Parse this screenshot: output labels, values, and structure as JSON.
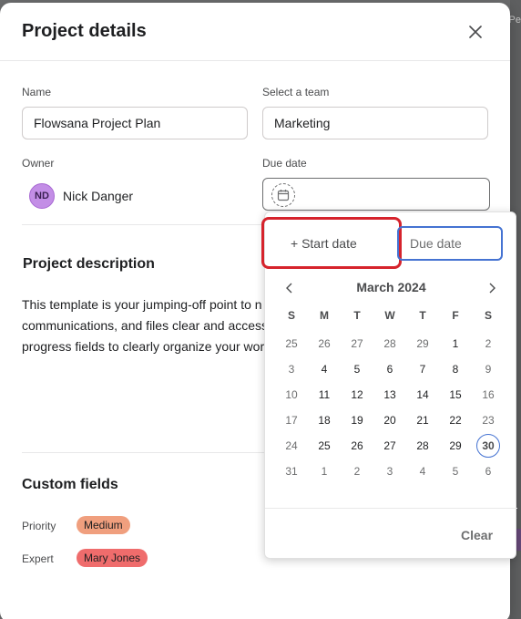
{
  "backdrop": {
    "text": "Pe"
  },
  "dialog": {
    "title": "Project details",
    "name_label": "Name",
    "name_value": "Flowsana Project Plan",
    "team_label": "Select a team",
    "team_value": "Marketing",
    "owner_label": "Owner",
    "owner_initials": "ND",
    "owner_name": "Nick Danger",
    "due_label": "Due date",
    "description_title": "Project description",
    "description_lines": [
      "This template is your jumping-off point to n",
      "communications, and files clear and accessi",
      "progress fields to clearly organize your wor"
    ],
    "custom_fields_title": "Custom fields",
    "custom_fields": [
      {
        "label": "Priority",
        "value": "Medium",
        "color": "#f09f7e"
      },
      {
        "label": "Expert",
        "value": "Mary Jones",
        "color": "#ef6c6c"
      }
    ]
  },
  "picker": {
    "start_date_label": "+ Start date",
    "due_date_placeholder": "Due date",
    "month": "March 2024",
    "weekdays": [
      "S",
      "M",
      "T",
      "W",
      "T",
      "F",
      "S"
    ],
    "weeks": [
      [
        [
          "25",
          true
        ],
        [
          "26",
          true
        ],
        [
          "27",
          true
        ],
        [
          "28",
          true
        ],
        [
          "29",
          true
        ],
        [
          "1",
          false
        ],
        [
          "2",
          true
        ]
      ],
      [
        [
          "3",
          true
        ],
        [
          "4",
          false
        ],
        [
          "5",
          false
        ],
        [
          "6",
          false
        ],
        [
          "7",
          false
        ],
        [
          "8",
          false
        ],
        [
          "9",
          true
        ]
      ],
      [
        [
          "10",
          true
        ],
        [
          "11",
          false
        ],
        [
          "12",
          false
        ],
        [
          "13",
          false
        ],
        [
          "14",
          false
        ],
        [
          "15",
          false
        ],
        [
          "16",
          true
        ]
      ],
      [
        [
          "17",
          true
        ],
        [
          "18",
          false
        ],
        [
          "19",
          false
        ],
        [
          "20",
          false
        ],
        [
          "21",
          false
        ],
        [
          "22",
          false
        ],
        [
          "23",
          true
        ]
      ],
      [
        [
          "24",
          true
        ],
        [
          "25",
          false
        ],
        [
          "26",
          false
        ],
        [
          "27",
          false
        ],
        [
          "28",
          false
        ],
        [
          "29",
          false
        ],
        [
          "30",
          false
        ]
      ],
      [
        [
          "31",
          true
        ],
        [
          "1",
          true
        ],
        [
          "2",
          true
        ],
        [
          "3",
          true
        ],
        [
          "4",
          true
        ],
        [
          "5",
          true
        ],
        [
          "6",
          true
        ]
      ]
    ],
    "today": "30",
    "clear_label": "Clear"
  },
  "colors": {
    "accent": "#4573d2",
    "highlight": "#d6232c",
    "avatar": "#c38ee6"
  }
}
